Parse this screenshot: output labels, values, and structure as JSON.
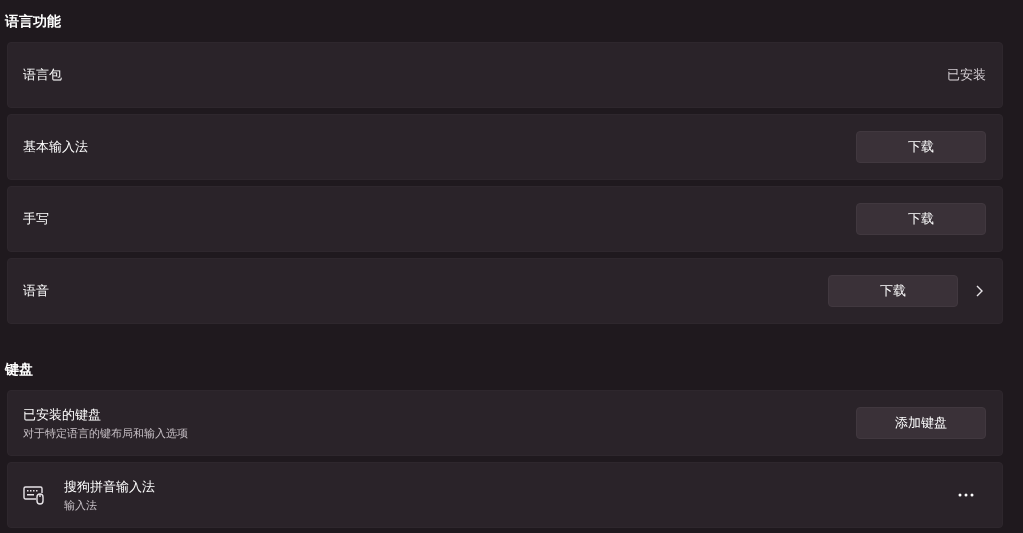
{
  "sections": [
    {
      "title": "语言功能",
      "rows": [
        {
          "kind": "status",
          "label": "语言包",
          "status": "已安装"
        },
        {
          "kind": "button",
          "label": "基本输入法",
          "button": "下载"
        },
        {
          "kind": "button",
          "label": "手写",
          "button": "下载"
        },
        {
          "kind": "button-link",
          "label": "语音",
          "button": "下载"
        }
      ]
    },
    {
      "title": "键盘",
      "rows": [
        {
          "kind": "button",
          "label": "已安装的键盘",
          "description": "对于特定语言的键布局和输入选项",
          "button": "添加键盘"
        },
        {
          "kind": "keyboard",
          "label": "搜狗拼音输入法",
          "description": "输入法"
        }
      ]
    }
  ]
}
